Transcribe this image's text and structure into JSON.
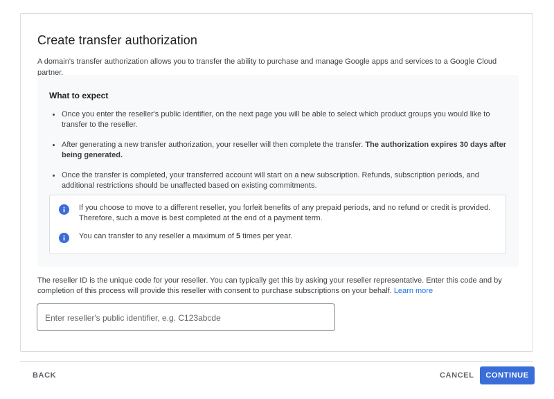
{
  "dialog": {
    "title": "Create transfer authorization",
    "intro": "A domain's transfer authorization allows you to transfer the ability to purchase and manage Google apps and services to a Google Cloud partner."
  },
  "expect": {
    "heading": "What to expect",
    "bullets": [
      {
        "text": "Once you enter the reseller's public identifier, on the next page you will be able to select which product groups you would like to transfer to the reseller.",
        "bold": ""
      },
      {
        "text": "After generating a new transfer authorization, your reseller will then complete the transfer. ",
        "bold": "The authorization expires 30 days after being generated."
      },
      {
        "text": "Once the transfer is completed, your transferred account will start on a new subscription. Refunds, subscription periods, and additional restrictions should be unaffected based on existing commitments.",
        "bold": ""
      }
    ],
    "info": [
      {
        "icon": "info-icon",
        "text": "If you choose to move to a different reseller, you forfeit benefits of any prepaid periods, and no refund or credit is provided. Therefore, such a move is best completed at the end of a payment term."
      },
      {
        "icon": "info-icon",
        "text_before": "You can transfer to any reseller a maximum of ",
        "bold": "5",
        "text_after": " times per year."
      }
    ]
  },
  "reseller": {
    "description": "The reseller ID is the unique code for your reseller. You can typically get this by asking your reseller representative. Enter this code and by completion of this process will provide this reseller with consent to purchase subscriptions on your behalf. ",
    "learn_more": "Learn more",
    "input_placeholder": "Enter reseller's public identifier, e.g. C123abcde",
    "input_value": ""
  },
  "footer": {
    "back_label": "BACK",
    "cancel_label": "CANCEL",
    "continue_label": "CONTINUE"
  },
  "colors": {
    "primary": "#3b6dd8",
    "link": "#1a73e8",
    "info_icon": "#3b6dd8",
    "panel_bg": "#f8f9fa"
  }
}
